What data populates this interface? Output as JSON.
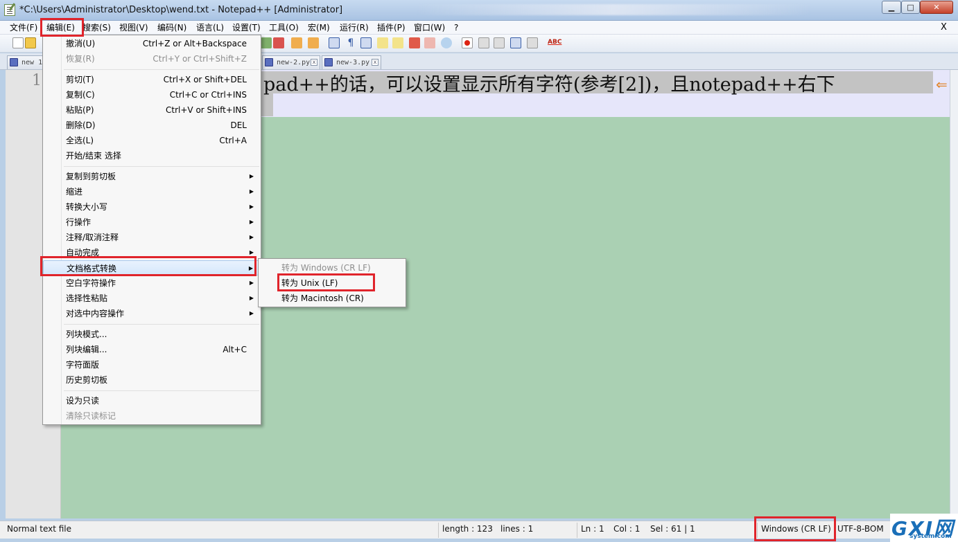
{
  "window": {
    "title": "*C:\\Users\\Administrator\\Desktop\\wend.txt - Notepad++ [Administrator]",
    "minimize": "▁",
    "maximize": "□",
    "close": "✕"
  },
  "menubar": {
    "items": [
      "文件(F)",
      "编辑(E)",
      "搜索(S)",
      "视图(V)",
      "编码(N)",
      "语言(L)",
      "设置(T)",
      "工具(O)",
      "宏(M)",
      "运行(R)",
      "插件(P)",
      "窗口(W)",
      "?"
    ],
    "close": "X"
  },
  "tabs": [
    "new 1",
    "new-2.py",
    "new-3.py"
  ],
  "editor": {
    "line_number": "1",
    "text": "pad++的话，可以设置显示所有字符(参考[2])，且notepad++右下",
    "wrap_symbol": "⇐"
  },
  "edit_menu": {
    "items": [
      {
        "label": "撤消(U)",
        "shortcut": "Ctrl+Z or Alt+Backspace",
        "disabled": false
      },
      {
        "label": "恢复(R)",
        "shortcut": "Ctrl+Y or Ctrl+Shift+Z",
        "disabled": true
      },
      {
        "label": "剪切(T)",
        "shortcut": "Ctrl+X or Shift+DEL",
        "disabled": false
      },
      {
        "label": "复制(C)",
        "shortcut": "Ctrl+C or Ctrl+INS",
        "disabled": false
      },
      {
        "label": "粘贴(P)",
        "shortcut": "Ctrl+V or Shift+INS",
        "disabled": false
      },
      {
        "label": "删除(D)",
        "shortcut": "DEL",
        "disabled": false
      },
      {
        "label": "全选(L)",
        "shortcut": "Ctrl+A",
        "disabled": false
      },
      {
        "label": "开始/结束 选择",
        "shortcut": "",
        "disabled": false
      },
      {
        "label": "复制到剪切板",
        "submenu": true
      },
      {
        "label": "缩进",
        "submenu": true
      },
      {
        "label": "转换大小写",
        "submenu": true
      },
      {
        "label": "行操作",
        "submenu": true
      },
      {
        "label": "注释/取消注释",
        "submenu": true
      },
      {
        "label": "自动完成",
        "submenu": true
      },
      {
        "label": "文档格式转换",
        "submenu": true
      },
      {
        "label": "空白字符操作",
        "submenu": true
      },
      {
        "label": "选择性粘贴",
        "submenu": true
      },
      {
        "label": "对选中内容操作",
        "submenu": true
      },
      {
        "label": "列块模式...",
        "shortcut": ""
      },
      {
        "label": "列块编辑...",
        "shortcut": "Alt+C"
      },
      {
        "label": "字符面版",
        "shortcut": ""
      },
      {
        "label": "历史剪切板",
        "shortcut": ""
      },
      {
        "label": "设为只读",
        "shortcut": ""
      },
      {
        "label": "清除只读标记",
        "shortcut": "",
        "disabled": true
      }
    ],
    "arrow": "▶"
  },
  "sub_menu": {
    "items": [
      {
        "label": "转为 Windows (CR LF)",
        "disabled": true
      },
      {
        "label": "转为 Unix (LF)",
        "disabled": false
      },
      {
        "label": "转为 Macintosh (CR)",
        "disabled": false
      }
    ]
  },
  "status": {
    "type": "Normal text file",
    "length": "length : 123",
    "lines": "lines : 1",
    "ln": "Ln : 1",
    "col": "Col : 1",
    "sel": "Sel : 61 | 1",
    "eol": "Windows (CR LF)",
    "encoding": "UTF-8-BOM"
  },
  "watermark": {
    "main": "GXI网",
    "sub": "system.com"
  },
  "colors": {
    "editor_bg": "#aad0b3",
    "annotation_red": "#e0242b"
  }
}
